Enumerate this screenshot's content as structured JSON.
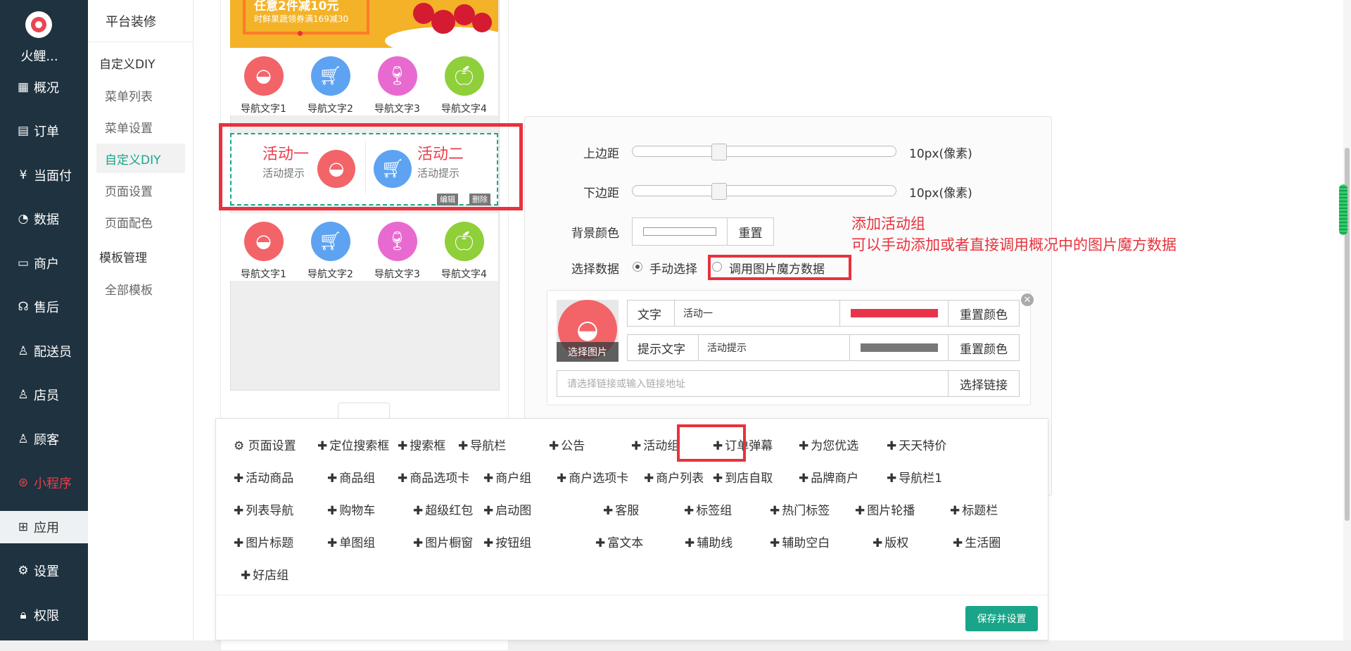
{
  "app": {
    "brand": "火鲤..."
  },
  "sidebar": {
    "items": [
      {
        "label": "概况",
        "icon": "dashboard-icon",
        "glyph": "▦"
      },
      {
        "label": "订单",
        "icon": "order-icon",
        "glyph": "▤"
      },
      {
        "label": "当面付",
        "icon": "yen-icon",
        "glyph": "¥"
      },
      {
        "label": "数据",
        "icon": "chart-icon",
        "glyph": "◔"
      },
      {
        "label": "商户",
        "icon": "store-icon",
        "glyph": "▭"
      },
      {
        "label": "售后",
        "icon": "headset-icon",
        "glyph": "☊"
      },
      {
        "label": "配送员",
        "icon": "user-icon",
        "glyph": "♙"
      },
      {
        "label": "店员",
        "icon": "staff-icon",
        "glyph": "♙"
      },
      {
        "label": "顾客",
        "icon": "customer-icon",
        "glyph": "♙"
      },
      {
        "label": "小程序",
        "icon": "miniapp-icon",
        "glyph": "⊛"
      },
      {
        "label": "应用",
        "icon": "apps-icon",
        "glyph": "⊞"
      },
      {
        "label": "设置",
        "icon": "gear-icon",
        "glyph": "⚙"
      },
      {
        "label": "权限",
        "icon": "lock-icon",
        "glyph": "🔒︎"
      }
    ]
  },
  "subnav": {
    "title": "平台装修",
    "group1": "自定义DIY",
    "group1_items": [
      "菜单列表",
      "菜单设置",
      "自定义DIY",
      "页面设置",
      "页面配色"
    ],
    "group2": "模板管理",
    "group2_items": [
      "全部模板"
    ]
  },
  "preview": {
    "banner_line1": "任意2件减10元",
    "banner_line2": "时鲜果蔬领券满169减30",
    "nav_labels": [
      "导航文字1",
      "导航文字2",
      "导航文字3",
      "导航文字4"
    ],
    "activity1_title": "活动一",
    "activity1_sub": "活动提示",
    "activity2_title": "活动二",
    "activity2_sub": "活动提示",
    "edit_label": "编辑",
    "delete_label": "删除"
  },
  "settings": {
    "top_margin_label": "上边距",
    "top_margin_value": "10px(像素)",
    "bottom_margin_label": "下边距",
    "bottom_margin_value": "10px(像素)",
    "bg_color_label": "背景颜色",
    "reset_label": "重置",
    "select_data_label": "选择数据",
    "manual_option": "手动选择",
    "magic_option": "调用图片魔方数据",
    "annotation_line1": "添加活动组",
    "annotation_line2": "可以手动添加或者直接调用概况中的图片魔方数据",
    "item": {
      "choose_image": "选择图片",
      "text_label": "文字",
      "text_value": "活动一",
      "text_color": "#e8334a",
      "reset_color": "重置颜色",
      "hint_label": "提示文字",
      "hint_value": "活动提示",
      "hint_color": "#777777",
      "link_placeholder": "请选择链接或输入链接地址",
      "choose_link": "选择链接"
    }
  },
  "components": {
    "page_settings": "页面设置",
    "items": [
      "定位搜索框",
      "搜索框",
      "导航栏",
      "公告",
      "活动组",
      "订单弹幕",
      "为您优选",
      "天天特价",
      "活动商品",
      "商品组",
      "商品选项卡",
      "商户组",
      "商户选项卡",
      "商户列表",
      "到店自取",
      "品牌商户",
      "导航栏1",
      "列表导航",
      "购物车",
      "超级红包",
      "启动图",
      "客服",
      "标签组",
      "热门标签",
      "图片轮播",
      "标题栏",
      "图片标题",
      "单图组",
      "图片橱窗",
      "按钮组",
      "富文本",
      "辅助线",
      "辅助空白",
      "版权",
      "生活圈",
      "好店组"
    ],
    "save_label": "保存并设置"
  },
  "colors": {
    "accent": "#1aa58a",
    "highlight": "#e8323c",
    "sidebar_bg": "#1f3240"
  }
}
